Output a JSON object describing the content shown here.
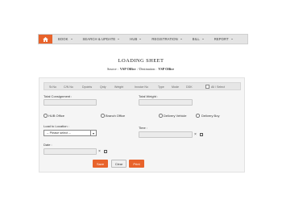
{
  "nav": {
    "home_icon": "home-icon",
    "items": [
      {
        "label": "BOOK"
      },
      {
        "label": "SEARCH & UPDATE"
      },
      {
        "label": "HUB"
      },
      {
        "label": "REGISTRATION"
      },
      {
        "label": "BILL"
      },
      {
        "label": "REPORT"
      }
    ]
  },
  "page": {
    "title": "LOADING SHEET",
    "source_label": "Source :",
    "source_value": "VSP Office",
    "separator": "/",
    "destination_label": "Destination :",
    "destination_value": "VSP Office"
  },
  "table": {
    "headers": [
      "Sr.No",
      "C/N No",
      "Dpoints",
      "Qnty",
      "Weight",
      "Invoice No",
      "Type",
      "Mode",
      "DDK"
    ],
    "all_select_label": "All / Select"
  },
  "form": {
    "total_consignment_label": "Total Consignment :",
    "total_consignment_value": "",
    "total_weight_label": "Total Weight :",
    "total_weight_value": "",
    "radio_hub_office": "HUB Office",
    "radio_branch_office": "Branch Office",
    "radio_delivery_vehicle": "Delivery Vehicle",
    "radio_delivery_boy": "Delivery Boy",
    "load_location_label": "Load to Location :",
    "load_location_selected": "-- Please select --",
    "time_label": "Time :",
    "time_value": "",
    "date_label": "Date :",
    "date_value": "",
    "clear_glyph": "×"
  },
  "buttons": {
    "save": "Save",
    "clear": "Clear",
    "print": "Print"
  },
  "colors": {
    "accent": "#e8632b",
    "nav_bg": "#e4e4e4",
    "panel_bg": "#f5f5f5"
  }
}
